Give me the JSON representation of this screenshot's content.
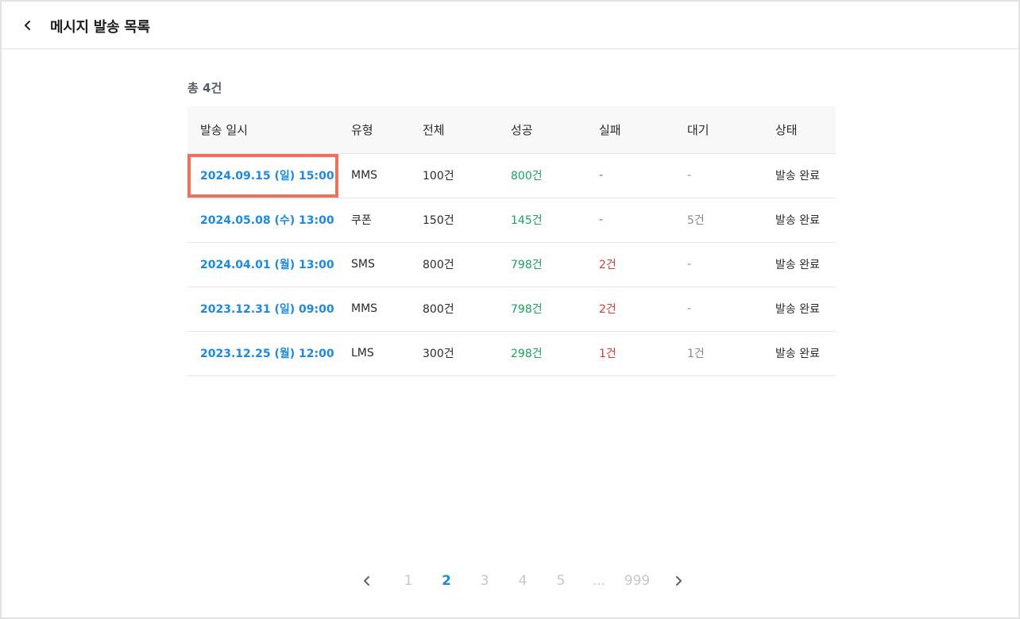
{
  "header": {
    "title": "메시지 발송 목록",
    "back_icon": "chevron-left-icon"
  },
  "summary": {
    "total_label": "총 4건"
  },
  "table": {
    "columns": [
      "발송 일시",
      "유형",
      "전체",
      "성공",
      "실패",
      "대기",
      "상태"
    ],
    "rows": [
      {
        "date": "2024.09.15 (일) 15:00",
        "type": "MMS",
        "total": "100건",
        "success": "800건",
        "fail": "-",
        "wait": "-",
        "status": "발송 완료",
        "highlighted": true
      },
      {
        "date": "2024.05.08 (수) 13:00",
        "type": "쿠폰",
        "total": "150건",
        "success": "145건",
        "fail": "-",
        "wait": "5건",
        "status": "발송 완료"
      },
      {
        "date": "2024.04.01 (월) 13:00",
        "type": "SMS",
        "total": "800건",
        "success": "798건",
        "fail": "2건",
        "wait": "-",
        "status": "발송 완료"
      },
      {
        "date": "2023.12.31 (일) 09:00",
        "type": "MMS",
        "total": "800건",
        "success": "798건",
        "fail": "2건",
        "wait": "-",
        "status": "발송 완료"
      },
      {
        "date": "2023.12.25 (월) 12:00",
        "type": "LMS",
        "total": "300건",
        "success": "298건",
        "fail": "1건",
        "wait": "1건",
        "status": "발송 완료"
      }
    ]
  },
  "pagination": {
    "prev_icon": "chevron-left-icon",
    "next_icon": "chevron-right-icon",
    "pages": [
      "1",
      "2",
      "3",
      "4",
      "5",
      "...",
      "999"
    ],
    "current": "2"
  },
  "colors": {
    "link_blue": "#1a8ae6",
    "success_green": "#17a55d",
    "fail_red": "#e03a3a",
    "highlight_border": "#f0705a"
  }
}
